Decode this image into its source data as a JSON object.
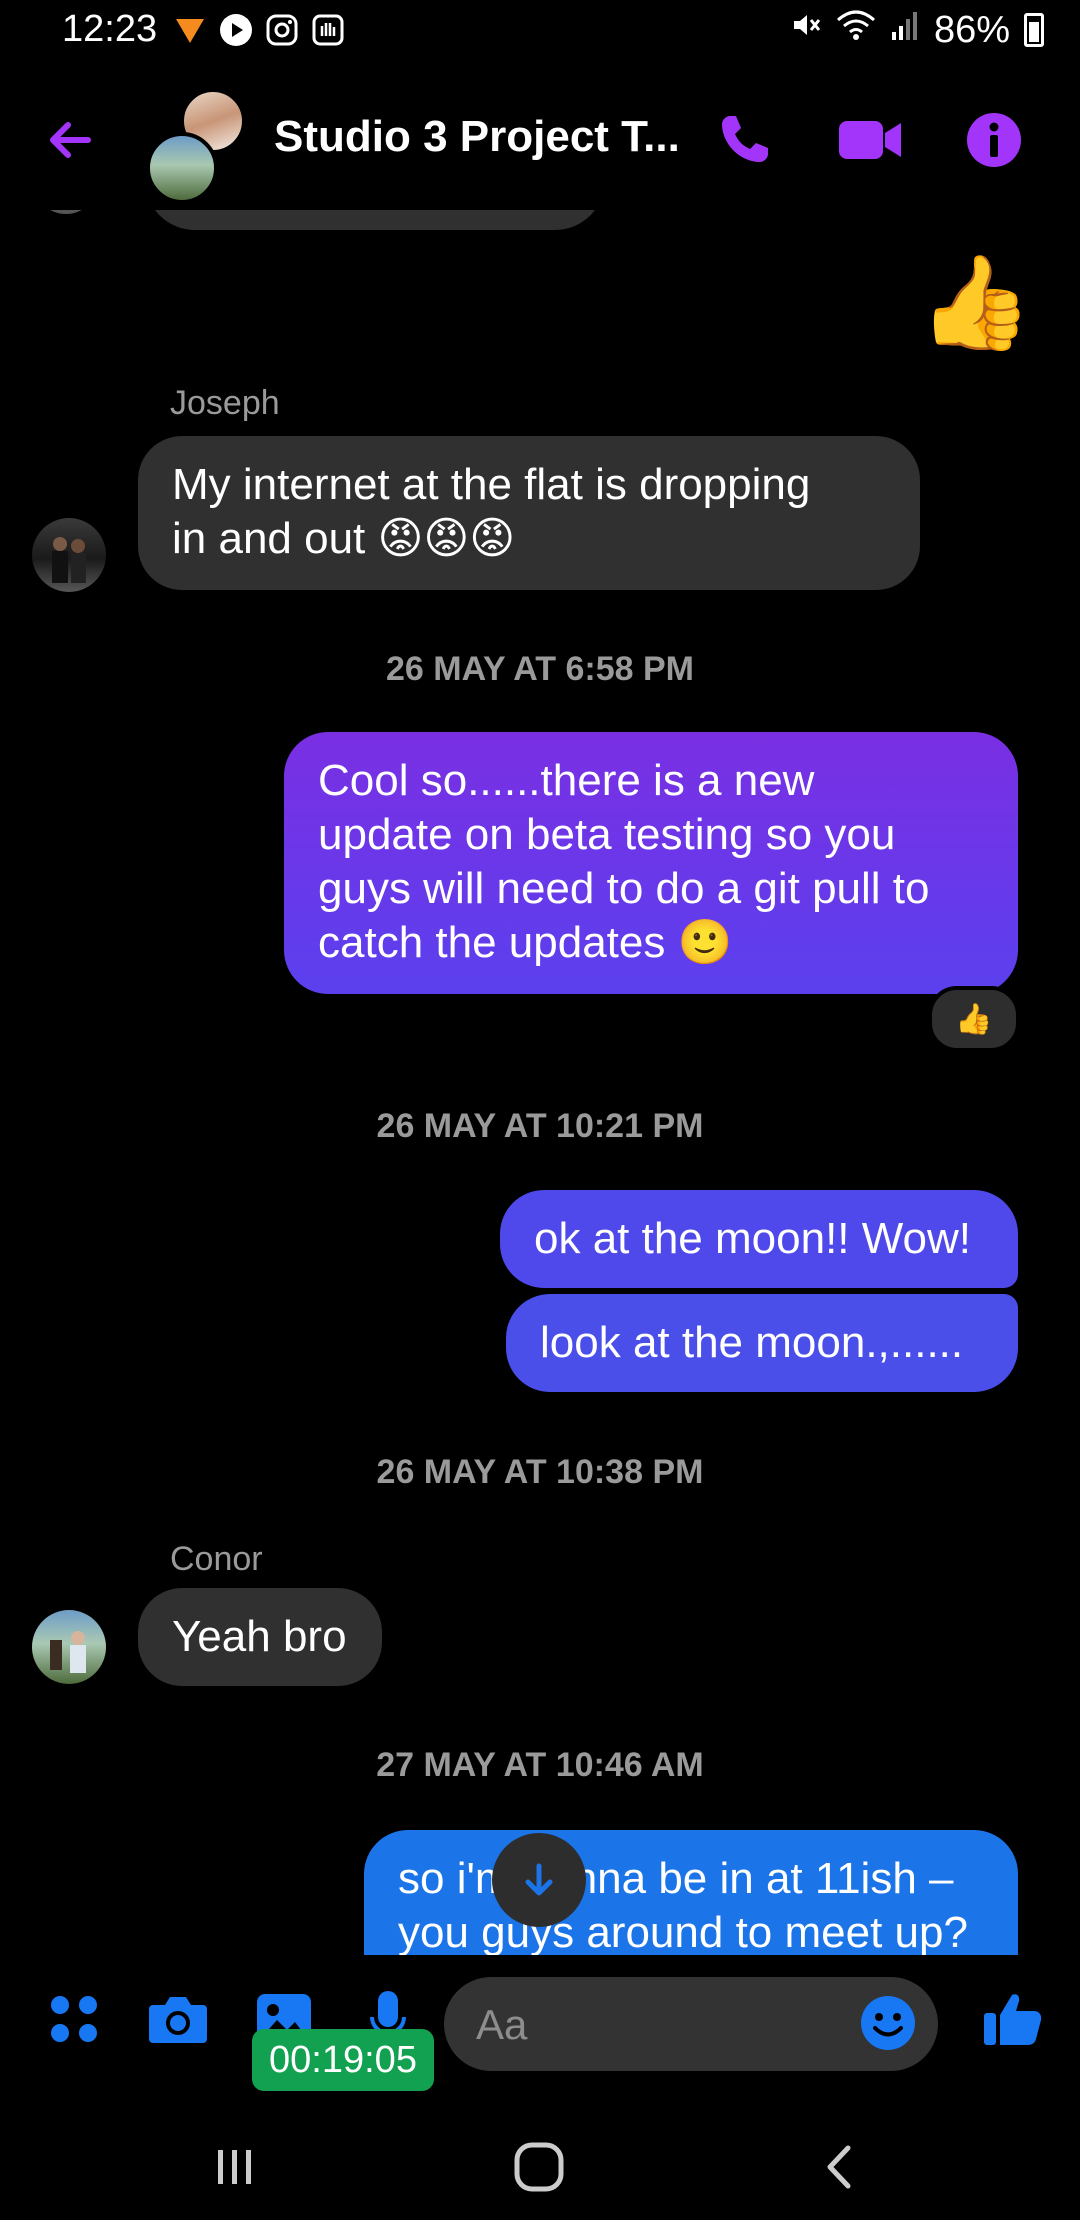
{
  "status_bar": {
    "time": "12:23",
    "battery": "86%",
    "app_icons": [
      "swiggy-icon",
      "play-icon",
      "instagram-icon",
      "hand-icon"
    ]
  },
  "header": {
    "title": "Studio 3 Project T...",
    "accent": "#a334fa"
  },
  "messages": {
    "sender1": "Joseph",
    "joseph_msg_line1": "My internet at the flat is dropping",
    "joseph_msg_line2": "in and out",
    "joseph_emojis": "😡😡😡",
    "stamp1": "26 MAY AT 6:58 PM",
    "out1_line1": "Cool so......there is a new",
    "out1_line2": "update on beta testing so you",
    "out1_line3": "guys will need to do a git pull to",
    "out1_line4": "catch the updates",
    "out1_emoji": "🙂",
    "reaction1": "👍",
    "stamp2": "26 MAY AT 10:21 PM",
    "out2": "ok at the moon!! Wow!",
    "out3": "look at the moon.,......",
    "stamp3": "26 MAY AT 10:38 PM",
    "sender2": "Conor",
    "conor_msg": "Yeah bro",
    "stamp4": "27 MAY AT 10:46 AM",
    "out4_line1": "so i'm gonna be in at 11ish –",
    "out4_line2": "you guys around to meet up?",
    "big_like": "👍"
  },
  "composer": {
    "placeholder": "Aa",
    "timer": "00:19:05"
  },
  "colors": {
    "out_purple_top": "#7b2fe6",
    "out_purple_bottom": "#5a3ff0",
    "out_indigo": "#4e49ea",
    "out_blue": "#1b74e8",
    "composer_blue": "#1877f2"
  }
}
